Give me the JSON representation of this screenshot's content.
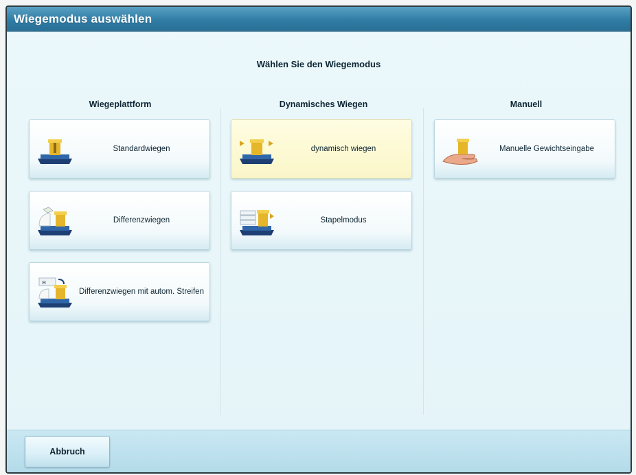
{
  "window": {
    "title": "Wiegemodus auswählen"
  },
  "prompt": "Wählen Sie den Wiegemodus",
  "columns": [
    {
      "header": "Wiegeplattform",
      "buttons": [
        {
          "label": "Standardwiegen",
          "icon": "standard-scale-icon"
        },
        {
          "label": "Differenzwiegen",
          "icon": "differential-scale-icon"
        },
        {
          "label": "Differenzwiegen mit autom. Streifen",
          "icon": "differential-auto-strip-icon"
        }
      ]
    },
    {
      "header": "Dynamisches Wiegen",
      "buttons": [
        {
          "label": "dynamisch wiegen",
          "icon": "dynamic-scale-icon",
          "selected": true
        },
        {
          "label": "Stapelmodus",
          "icon": "stack-mode-icon"
        }
      ]
    },
    {
      "header": "Manuell",
      "buttons": [
        {
          "label": "Manuelle Gewichtseingabe",
          "icon": "manual-weight-entry-icon"
        }
      ]
    }
  ],
  "footer": {
    "cancel_label": "Abbruch"
  },
  "colors": {
    "title_bar": "#2f7ca5",
    "background": "#e4f4f8",
    "selected_button": "#fbf6c8",
    "footer": "#b4dbe9"
  }
}
